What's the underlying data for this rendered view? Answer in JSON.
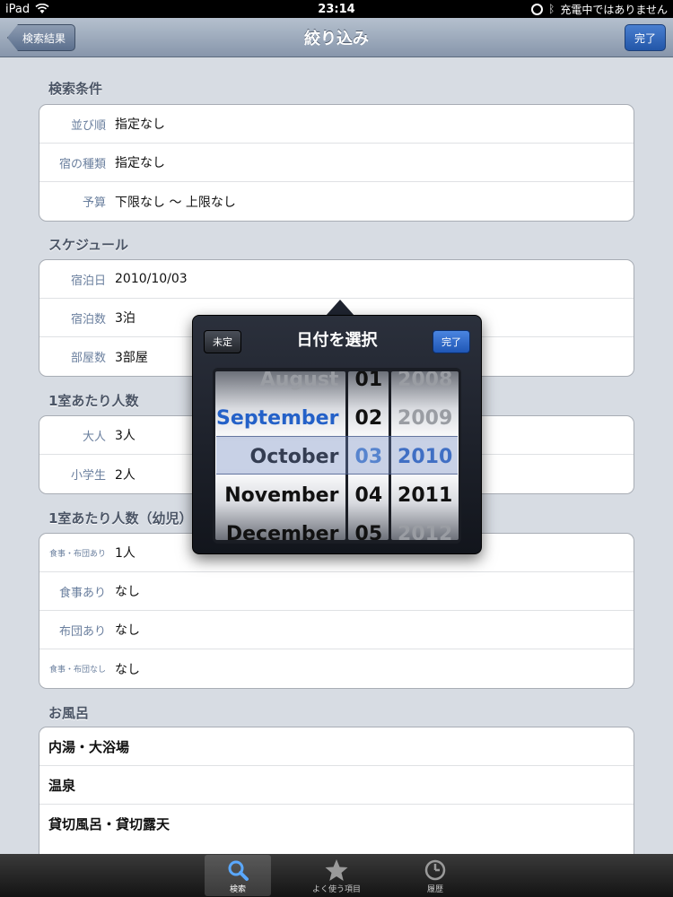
{
  "status_bar": {
    "device": "iPad",
    "time": "23:14",
    "charging": "充電中ではありません"
  },
  "nav": {
    "back_label": "検索結果",
    "title": "絞り込み",
    "done_label": "完了"
  },
  "sections": {
    "search": {
      "title": "検索条件",
      "rows": [
        {
          "label": "並び順",
          "value": "指定なし"
        },
        {
          "label": "宿の種類",
          "value": "指定なし"
        },
        {
          "label": "予算",
          "value": "下限なし 〜 上限なし"
        }
      ]
    },
    "schedule": {
      "title": "スケジュール",
      "rows": [
        {
          "label": "宿泊日",
          "value": "2010/10/03"
        },
        {
          "label": "宿泊数",
          "value": "3泊"
        },
        {
          "label": "部屋数",
          "value": "3部屋"
        }
      ]
    },
    "per_room": {
      "title": "1室あたり人数",
      "rows": [
        {
          "label": "大人",
          "value": "3人"
        },
        {
          "label": "小学生",
          "value": "2人"
        }
      ]
    },
    "per_room_infant": {
      "title": "1室あたり人数（幼児）",
      "rows": [
        {
          "label": "食事・布団あり",
          "value": "1人"
        },
        {
          "label": "食事あり",
          "value": "なし"
        },
        {
          "label": "布団あり",
          "value": "なし"
        },
        {
          "label": "食事・布団なし",
          "value": "なし"
        }
      ]
    },
    "bath": {
      "title": "お風呂",
      "rows": [
        {
          "label": "内湯・大浴場"
        },
        {
          "label": "温泉"
        },
        {
          "label": "貸切風呂・貸切露天"
        }
      ]
    }
  },
  "date_picker": {
    "title": "日付を選択",
    "cancel_label": "未定",
    "done_label": "完了",
    "months": [
      "August",
      "September",
      "October",
      "November",
      "December"
    ],
    "days": [
      "01",
      "02",
      "03",
      "04",
      "05"
    ],
    "years": [
      "2008",
      "2009",
      "2010",
      "2011",
      "2012"
    ],
    "selected": {
      "month": "October",
      "day": "03",
      "year": "2010"
    }
  },
  "tab_bar": {
    "tabs": [
      {
        "label": "検索",
        "icon": "search-icon",
        "active": true
      },
      {
        "label": "よく使う項目",
        "icon": "star-icon",
        "active": false
      },
      {
        "label": "履歴",
        "icon": "clock-icon",
        "active": false
      }
    ]
  },
  "colors": {
    "nav_gradient_top": "#b5c0ce",
    "label_blue": "#6a7f9e",
    "done_blue": "#2256a8",
    "picker_selected_blue": "#2461c8"
  }
}
